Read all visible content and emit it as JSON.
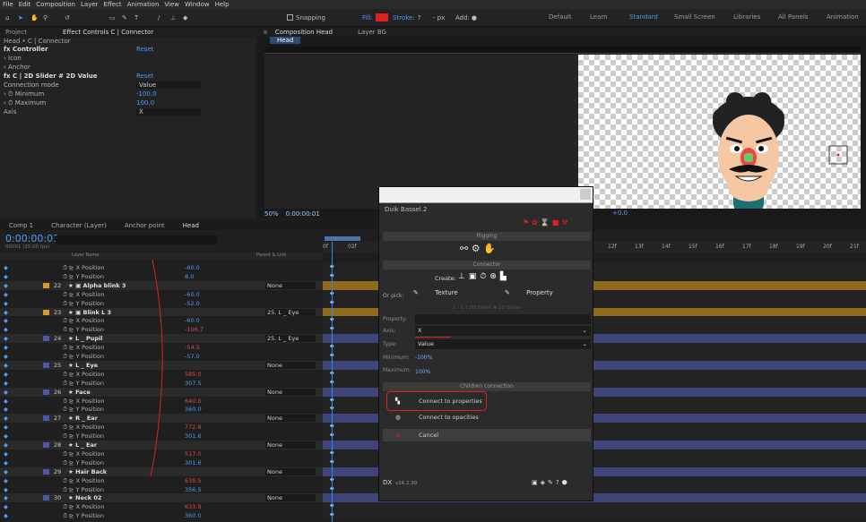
{
  "menu": [
    "File",
    "Edit",
    "Composition",
    "Layer",
    "Effect",
    "Animation",
    "View",
    "Window",
    "Help"
  ],
  "toolbar": {
    "snapping": "Snapping",
    "fill": "Fill:",
    "stroke": "Stroke:",
    "stroke_val": "?",
    "px": "- px",
    "add": "Add:",
    "workspaces": [
      "Default",
      "Learn",
      "Standard",
      "Small Screen",
      "Libraries",
      "All Panels",
      "Animation"
    ]
  },
  "colors": {
    "accent": "#2d8ceb",
    "red": "#e02020",
    "orange": "#d79a2b",
    "purple": "#4f56a6",
    "bg": "#1d1d1d"
  },
  "ec": {
    "tab_project": "Project",
    "tab_effect": "Effect Controls C | Connector",
    "breadcrumb": "Head • C | Connector",
    "rows": [
      {
        "label": "fx  Controller",
        "value": "Reset",
        "bold": true
      },
      {
        "label": "› Icon",
        "value": ""
      },
      {
        "label": "› Anchor",
        "value": ""
      },
      {
        "label": "fx  C | 2D Slider # 2D Value",
        "value": "Reset",
        "bold": true
      },
      {
        "label": "Connection mode",
        "value": "Value",
        "dd": true
      },
      {
        "label": "› ⏱ Minimum",
        "value": "-100.0"
      },
      {
        "label": "› ⏱ Maximum",
        "value": "100.0"
      },
      {
        "label": "Axis",
        "value": "X",
        "dd": true
      }
    ]
  },
  "comp": {
    "tab": "Composition Head",
    "tab2": "Layer BG",
    "subtab": "Head",
    "zoom": "50%",
    "time": "0:00:00:01",
    "offset": "+0.0"
  },
  "tl": {
    "tabs": [
      "Comp 1",
      "Character (Layer)",
      "Anchor point",
      "Head"
    ],
    "time": "0:00:00:01",
    "fps": "00001 (25.00 fps)",
    "col_layer": "Layer Name",
    "col_parent": "Parent & Link",
    "ticks": [
      "0f",
      "02f",
      "12f",
      "13f",
      "14f",
      "15f",
      "16f",
      "17f",
      "18f",
      "19f",
      "20f",
      "21f"
    ],
    "rows": [
      {
        "n": "",
        "name": "⏱ ⊵ X Position",
        "val": "-60.0",
        "type": "p"
      },
      {
        "n": "",
        "name": "⏱ ⊵ Y Position",
        "val": "8.0",
        "type": "p"
      },
      {
        "n": "22",
        "name": "★ ▣ Alpha blink 3",
        "val": "",
        "par": "None",
        "type": "l",
        "c": "#d79a2b"
      },
      {
        "n": "",
        "name": "⏱ ⊵ X Position",
        "val": "-60.0",
        "type": "p"
      },
      {
        "n": "",
        "name": "⏱ ⊵ Y Position",
        "val": "-52.0",
        "type": "p"
      },
      {
        "n": "23",
        "name": "★ ▣ Blink L 3",
        "val": "",
        "par": "25. L _ Eye",
        "type": "l",
        "c": "#d79a2b"
      },
      {
        "n": "",
        "name": "⏱ ⊵ X Position",
        "val": "-60.0",
        "type": "p"
      },
      {
        "n": "",
        "name": "⏱ ⊵ Y Position",
        "val": "-106.7",
        "type": "p",
        "red": true
      },
      {
        "n": "24",
        "name": "★ L _ Pupil",
        "val": "",
        "par": "25. L _ Eye",
        "type": "l",
        "c": "#4f56a6"
      },
      {
        "n": "",
        "name": "⏱ ⊵ X Position",
        "val": "-54.5",
        "type": "p",
        "red": true
      },
      {
        "n": "",
        "name": "⏱ ⊵ Y Position",
        "val": "-57.0",
        "type": "p"
      },
      {
        "n": "25",
        "name": "★ L _ Eye",
        "val": "",
        "par": "None",
        "type": "l",
        "c": "#4f56a6"
      },
      {
        "n": "",
        "name": "⏱ ⊵ X Position",
        "val": "585.0",
        "type": "p",
        "red": true
      },
      {
        "n": "",
        "name": "⏱ ⊵ Y Position",
        "val": "307.5",
        "type": "p"
      },
      {
        "n": "26",
        "name": "★ Face",
        "val": "",
        "par": "None",
        "type": "l",
        "c": "#4f56a6"
      },
      {
        "n": "",
        "name": "⏱ ⊵ X Position",
        "val": "640.0",
        "type": "p",
        "red": true
      },
      {
        "n": "",
        "name": "⏱ ⊵ Y Position",
        "val": "360.0",
        "type": "p"
      },
      {
        "n": "27",
        "name": "★ R _ Ear",
        "val": "",
        "par": "None",
        "type": "l",
        "c": "#4f56a6"
      },
      {
        "n": "",
        "name": "⏱ ⊵ X Position",
        "val": "772.8",
        "type": "p",
        "red": true
      },
      {
        "n": "",
        "name": "⏱ ⊵ Y Position",
        "val": "301.6",
        "type": "p"
      },
      {
        "n": "28",
        "name": "★ L _ Ear",
        "val": "",
        "par": "None",
        "type": "l",
        "c": "#4f56a6"
      },
      {
        "n": "",
        "name": "⏱ ⊵ X Position",
        "val": "517.0",
        "type": "p",
        "red": true
      },
      {
        "n": "",
        "name": "⏱ ⊵ Y Position",
        "val": "301.6",
        "type": "p"
      },
      {
        "n": "29",
        "name": "★ Hair Back",
        "val": "",
        "par": "None",
        "type": "l",
        "c": "#4f56a6"
      },
      {
        "n": "",
        "name": "⏱ ⊵ X Position",
        "val": "639.5",
        "type": "p",
        "red": true
      },
      {
        "n": "",
        "name": "⏱ ⊵ Y Position",
        "val": "356.5",
        "type": "p"
      },
      {
        "n": "30",
        "name": "★ Neck 02",
        "val": "",
        "par": "None",
        "type": "l",
        "c": "#4f56a6"
      },
      {
        "n": "",
        "name": "⏱ ⊵ X Position",
        "val": "633.9",
        "type": "p",
        "red": true
      },
      {
        "n": "",
        "name": "⏱ ⊵ Y Position",
        "val": "360.0",
        "type": "p"
      }
    ]
  },
  "dialog": {
    "title": "Duik Bassel.2",
    "rigging": "Rigging",
    "connector": "Connector",
    "create": "Create:",
    "orpick": "Or pick:",
    "texture": "Texture",
    "property": "Property",
    "hint": "1 - C | 2D Slider # 2D Slider",
    "property_lbl": "Property:",
    "axis_lbl": "Axis:",
    "axis_val": "X",
    "type_lbl": "Type:",
    "type_val": "Value",
    "min_lbl": "Minimum:",
    "min_val": "-100%",
    "max_lbl": "Maximum:",
    "max_val": "100%",
    "children": "Children connection",
    "btn_props": "Connect to properties",
    "btn_opac": "Connect to opacities",
    "btn_cancel": "Cancel",
    "version": "v16.2.30"
  }
}
